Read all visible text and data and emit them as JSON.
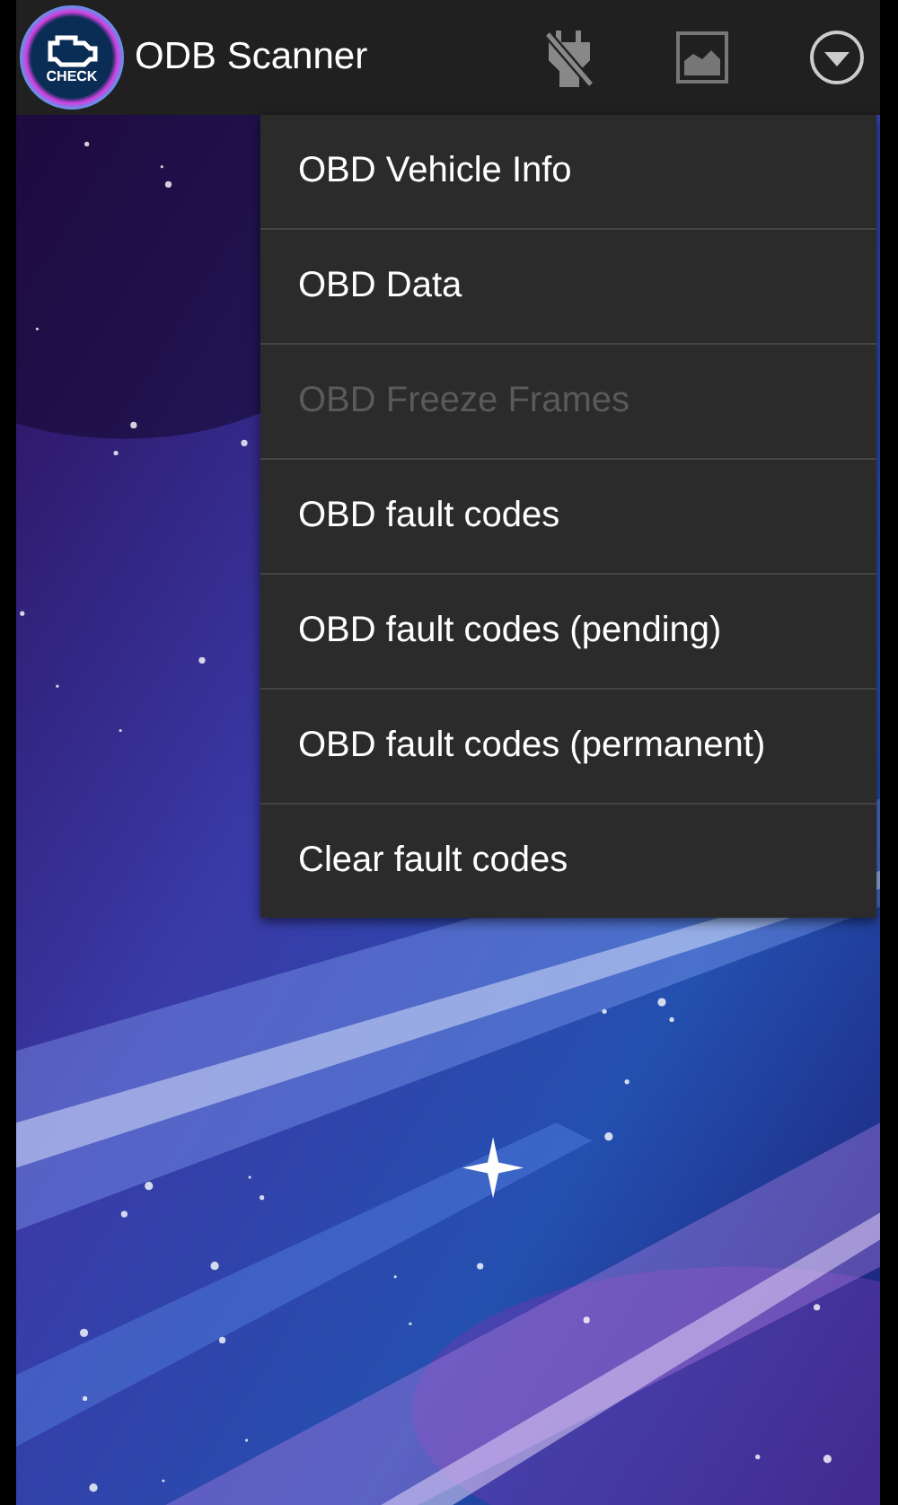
{
  "app_bar": {
    "logo_text": "CHECK",
    "title": "ODB Scanner"
  },
  "menu": {
    "items": [
      {
        "label": "OBD Vehicle Info",
        "disabled": false
      },
      {
        "label": "OBD Data",
        "disabled": false
      },
      {
        "label": "OBD Freeze Frames",
        "disabled": true
      },
      {
        "label": "OBD fault codes",
        "disabled": false
      },
      {
        "label": "OBD fault codes (pending)",
        "disabled": false
      },
      {
        "label": "OBD fault codes (permanent)",
        "disabled": false
      },
      {
        "label": "Clear fault codes",
        "disabled": false
      }
    ]
  }
}
